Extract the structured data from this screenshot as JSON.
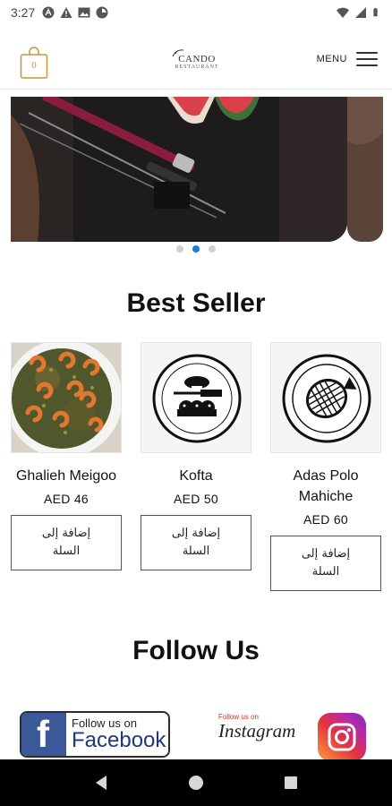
{
  "status_bar": {
    "time": "3:27",
    "left_icons": [
      "autofill-icon",
      "warning-icon",
      "gallery-icon",
      "app-icon"
    ],
    "right_icons": [
      "wifi-icon",
      "signal-icon",
      "battery-icon"
    ]
  },
  "header": {
    "cart_count": "0",
    "logo_name": "CANDO",
    "logo_sub": "RESTAURANT",
    "menu_label": "MENU"
  },
  "slider": {
    "slide_count": 3,
    "active_index": 1
  },
  "best_seller": {
    "title": "Best Seller",
    "products": [
      {
        "name": "Ghalieh Meigoo",
        "price": "AED 46",
        "button": "إضافة إلى السلة",
        "image": "shrimp-curry-photo"
      },
      {
        "name": "Kofta",
        "price": "AED 50",
        "button": "إضافة إلى السلة",
        "image": "kofta-plate-icon"
      },
      {
        "name": "Adas Polo Mahiche",
        "price": "AED 60",
        "button": "إضافة إلى السلة",
        "image": "fish-plate-icon"
      }
    ]
  },
  "follow": {
    "title": "Follow Us",
    "facebook_line1": "Follow us on",
    "facebook_line2": "Facebook",
    "instagram_small": "Follow us on",
    "instagram_word": "Instagram"
  },
  "colors": {
    "accent_gold": "#c7953a",
    "dot_active": "#1f7ae0",
    "facebook_blue": "#3b5998"
  },
  "nav": [
    "back-icon",
    "home-icon",
    "recents-icon"
  ]
}
